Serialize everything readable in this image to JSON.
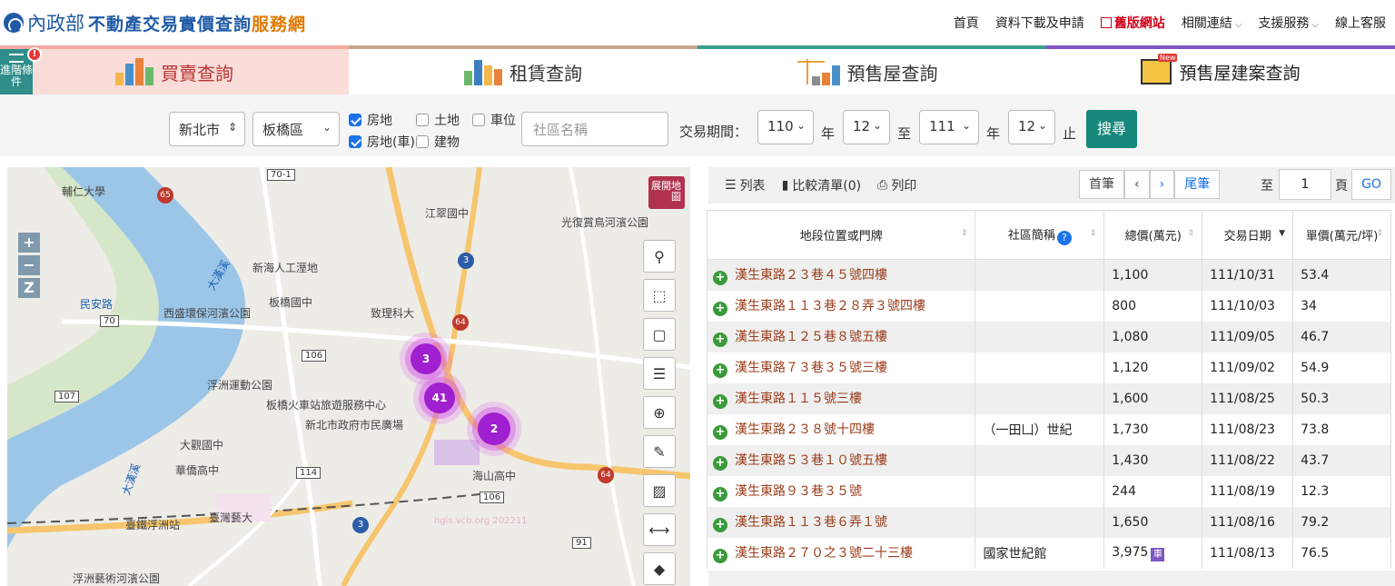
{
  "header": {
    "ministry": "內政部",
    "site_title_main": "不動產交易實價查詢",
    "site_title_accent": "服務網",
    "nav": [
      {
        "label": "首頁"
      },
      {
        "label": "資料下載及申請"
      },
      {
        "label": "舊版網站"
      },
      {
        "label": "相關連結"
      },
      {
        "label": "支援服務"
      },
      {
        "label": "線上客服"
      }
    ]
  },
  "advanced": {
    "label": "進階條件",
    "badge": "!"
  },
  "tabs": [
    {
      "label": "買賣查詢",
      "active": true
    },
    {
      "label": "租賃查詢",
      "active": false
    },
    {
      "label": "預售屋查詢",
      "active": false
    },
    {
      "label": "預售屋建案查詢",
      "active": false,
      "new_badge": "New"
    }
  ],
  "filters": {
    "city": "新北市",
    "district": "板橋區",
    "types": [
      {
        "label": "房地",
        "checked": true
      },
      {
        "label": "土地",
        "checked": false
      },
      {
        "label": "車位",
        "checked": false
      },
      {
        "label": "房地(車)",
        "checked": true
      },
      {
        "label": "建物",
        "checked": false
      }
    ],
    "community_placeholder": "社區名稱",
    "period_label": "交易期間：",
    "from_year": "110",
    "from_month": "12",
    "to_year": "111",
    "to_month": "12",
    "year_unit": "年",
    "to_word": "至",
    "end_word": "止",
    "search_label": "搜尋"
  },
  "map": {
    "expand_label": "展開地圖",
    "zoom_in": "+",
    "zoom_out": "−",
    "zoom_z": "Z",
    "clusters": [
      {
        "count": "3"
      },
      {
        "count": "41"
      },
      {
        "count": "2"
      }
    ],
    "labels": {
      "fu_jen": "輔仁大學",
      "jiangcui": "江翠國中",
      "guangfu": "光復賞鳥河濱公園",
      "xinhai": "新海人工溼地",
      "bandiao": "板橋國中",
      "xisheng": "西盛環保河濱公園",
      "zhili": "致理科大",
      "fuzhou": "浮洲運動公園",
      "station": "板橋火車站旅遊服務中心",
      "govt": "新北市政府市民廣場",
      "dagwan": "大觀國中",
      "huaqiao": "華僑高中",
      "haishan": "海山高中",
      "taiwan_art": "臺灣藝大",
      "fuzhou_station": "臺鐵浮洲站",
      "fuzhou_art": "浮洲藝術河濱公園",
      "minsheng": "民安路",
      "hanhe": "大漢溪",
      "xindian": "大漢溪",
      "watermark": "hgis.vcb.org 202211"
    },
    "road_shields": [
      "65",
      "106",
      "107",
      "114",
      "106",
      "91",
      "70",
      "70-1",
      "64",
      "3",
      "64",
      "3"
    ]
  },
  "results": {
    "toolbar": {
      "list": "列表",
      "compare": "比較清單(0)",
      "print": "列印"
    },
    "pager": {
      "first": "首筆",
      "prev": "‹",
      "next": "›",
      "last": "尾筆",
      "to": "至",
      "page": "1",
      "page_unit": "頁",
      "go": "GO"
    },
    "columns": [
      "地段位置或門牌",
      "社區簡稱",
      "總價(萬元)",
      "交易日期",
      "單價(萬元/坪)"
    ],
    "rows": [
      {
        "address": "漢生東路２３巷４５號四樓",
        "community": "",
        "total": "1,100",
        "date": "111/10/31",
        "unit": "53.4",
        "car": false
      },
      {
        "address": "漢生東路１１３巷２８弄３號四樓",
        "community": "",
        "total": "800",
        "date": "111/10/03",
        "unit": "34",
        "car": false
      },
      {
        "address": "漢生東路１２５巷８號五樓",
        "community": "",
        "total": "1,080",
        "date": "111/09/05",
        "unit": "46.7",
        "car": false
      },
      {
        "address": "漢生東路７３巷３５號三樓",
        "community": "",
        "total": "1,120",
        "date": "111/09/02",
        "unit": "54.9",
        "car": false
      },
      {
        "address": "漢生東路１１５號三樓",
        "community": "",
        "total": "1,600",
        "date": "111/08/25",
        "unit": "50.3",
        "car": false
      },
      {
        "address": "漢生東路２３８號十四樓",
        "community": "（一田凵）世紀",
        "total": "1,730",
        "date": "111/08/23",
        "unit": "73.8",
        "car": false
      },
      {
        "address": "漢生東路５３巷１０號五樓",
        "community": "",
        "total": "1,430",
        "date": "111/08/22",
        "unit": "43.7",
        "car": false
      },
      {
        "address": "漢生東路９３巷３５號",
        "community": "",
        "total": "244",
        "date": "111/08/19",
        "unit": "12.3",
        "car": false
      },
      {
        "address": "漢生東路１１３巷６弄１號",
        "community": "",
        "total": "1,650",
        "date": "111/08/16",
        "unit": "79.2",
        "car": false
      },
      {
        "address": "漢生東路２７０之３號二十三樓",
        "community": "國家世紀館",
        "total": "3,975",
        "date": "111/08/13",
        "unit": "76.5",
        "car": true,
        "car_label": "車"
      }
    ]
  },
  "colors": {
    "brand": "#1f5aa6",
    "accent": "#e07a00",
    "search": "#16887b",
    "cluster": "#a01fd0",
    "address": "#9b3c1a"
  }
}
